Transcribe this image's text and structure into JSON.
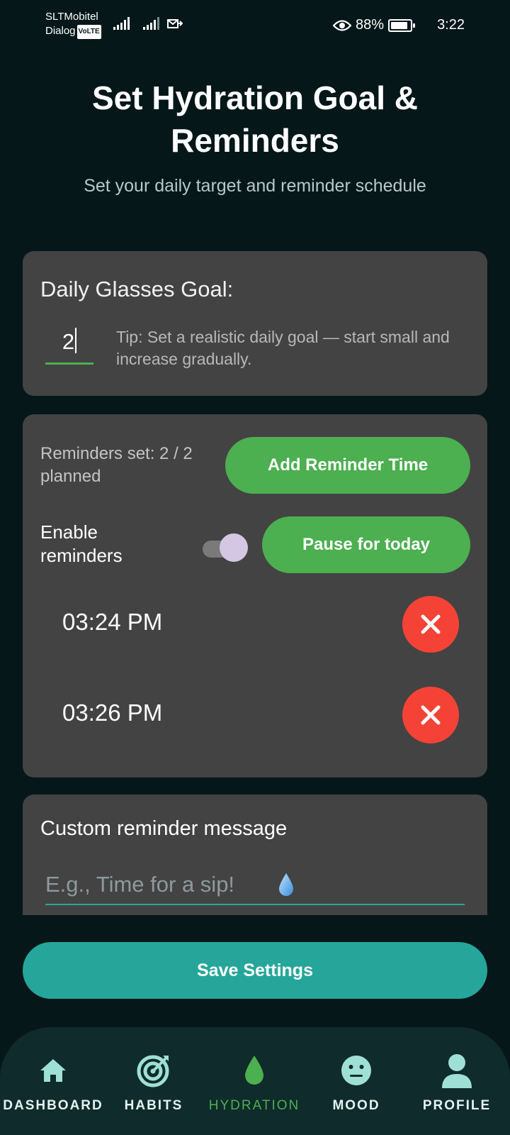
{
  "status_bar": {
    "carrier_top": "SLTMobitel",
    "carrier_bottom": "Dialog",
    "volte": "VoLTE",
    "battery": "88%",
    "battery_level": 0.88,
    "time": "3:22"
  },
  "header": {
    "title": "Set Hydration Goal & Reminders",
    "subtitle": "Set your daily target and reminder schedule"
  },
  "goal": {
    "label": "Daily Glasses Goal:",
    "value": "2",
    "tip": "Tip: Set a realistic daily goal — start small and increase gradually."
  },
  "reminders": {
    "count_text": "Reminders set: 2 / 2 planned",
    "add_label": "Add Reminder Time",
    "enable_label": "Enable reminders",
    "enabled": true,
    "pause_label": "Pause for today",
    "items": [
      {
        "time": "03:24 PM"
      },
      {
        "time": "03:26 PM"
      }
    ]
  },
  "message": {
    "label": "Custom reminder message",
    "placeholder": "E.g., Time for a sip!"
  },
  "save_label": "Save Settings",
  "nav": {
    "items": [
      {
        "label": "DASHBOARD",
        "icon": "home-icon"
      },
      {
        "label": "HABITS",
        "icon": "target-icon"
      },
      {
        "label": "HYDRATION",
        "icon": "water-drop-icon"
      },
      {
        "label": "MOOD",
        "icon": "neutral-face-icon"
      },
      {
        "label": "PROFILE",
        "icon": "person-icon"
      }
    ],
    "active": "HYDRATION"
  },
  "colors": {
    "background": "#051719",
    "card": "#434343",
    "primary_green": "#4caf50",
    "teal": "#26a69a",
    "danger": "#f44336",
    "nav_bg": "#0f2b2b"
  }
}
